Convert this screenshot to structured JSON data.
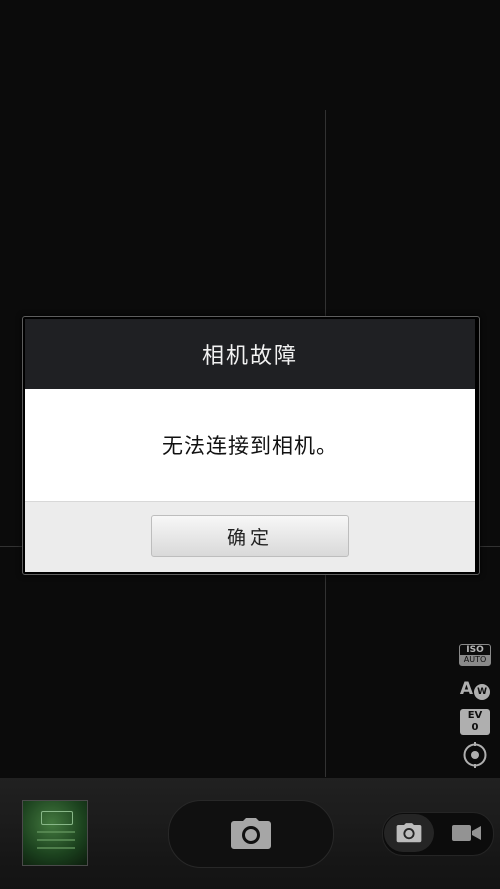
{
  "dialog": {
    "title": "相机故障",
    "message": "无法连接到相机。",
    "ok_label": "确定"
  },
  "side_controls": {
    "iso": {
      "top": "ISO",
      "bottom": "AUTO"
    },
    "white_balance": {
      "letter": "A",
      "badge": "W"
    },
    "exposure": {
      "label": "EV",
      "value": "0"
    },
    "focus_icon": "focus-target-icon"
  },
  "bottom_bar": {
    "thumbnail_icon": "last-photo-thumbnail",
    "shutter_icon": "camera-icon",
    "photo_mode_icon": "camera-icon",
    "video_mode_icon": "video-camera-icon"
  },
  "colors": {
    "background": "#0d0d0d",
    "dialog_title_bg": "#1f2023",
    "dialog_body_bg": "#ffffff",
    "dialog_footer_bg": "#ececec"
  }
}
